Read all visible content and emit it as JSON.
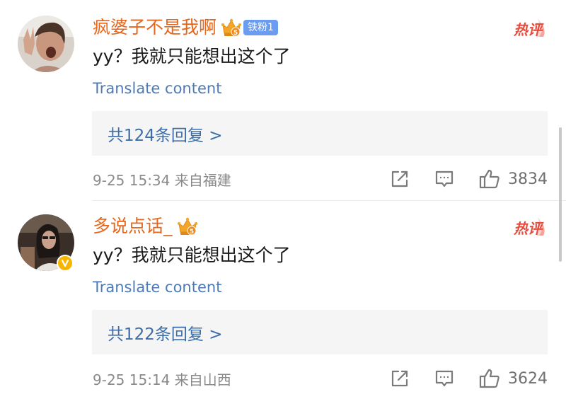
{
  "comments": [
    {
      "username": "疯婆子不是我啊",
      "fan_badge": "铁粉1",
      "hot_label": "热评",
      "text": "yy？我就只能想出这个了",
      "translate_label": "Translate content",
      "replies_label": "共124条回复 >",
      "meta": "9-25 15:34  来自福建",
      "likes": "3834"
    },
    {
      "username": "多说点话_",
      "hot_label": "热评",
      "text": "yy？我就只能想出这个了",
      "translate_label": "Translate content",
      "replies_label": "共122条回复 >",
      "meta": "9-25 15:14  来自山西",
      "likes": "3624"
    }
  ],
  "colors": {
    "username": "#e8651a",
    "link": "#4d7ab6",
    "hot": "#e84c3d",
    "badge": "#6b9cf0",
    "verified": "#f7b500"
  },
  "icons": [
    "share-icon",
    "comment-icon",
    "thumbs-up-icon",
    "crown-icon",
    "verified-icon"
  ]
}
